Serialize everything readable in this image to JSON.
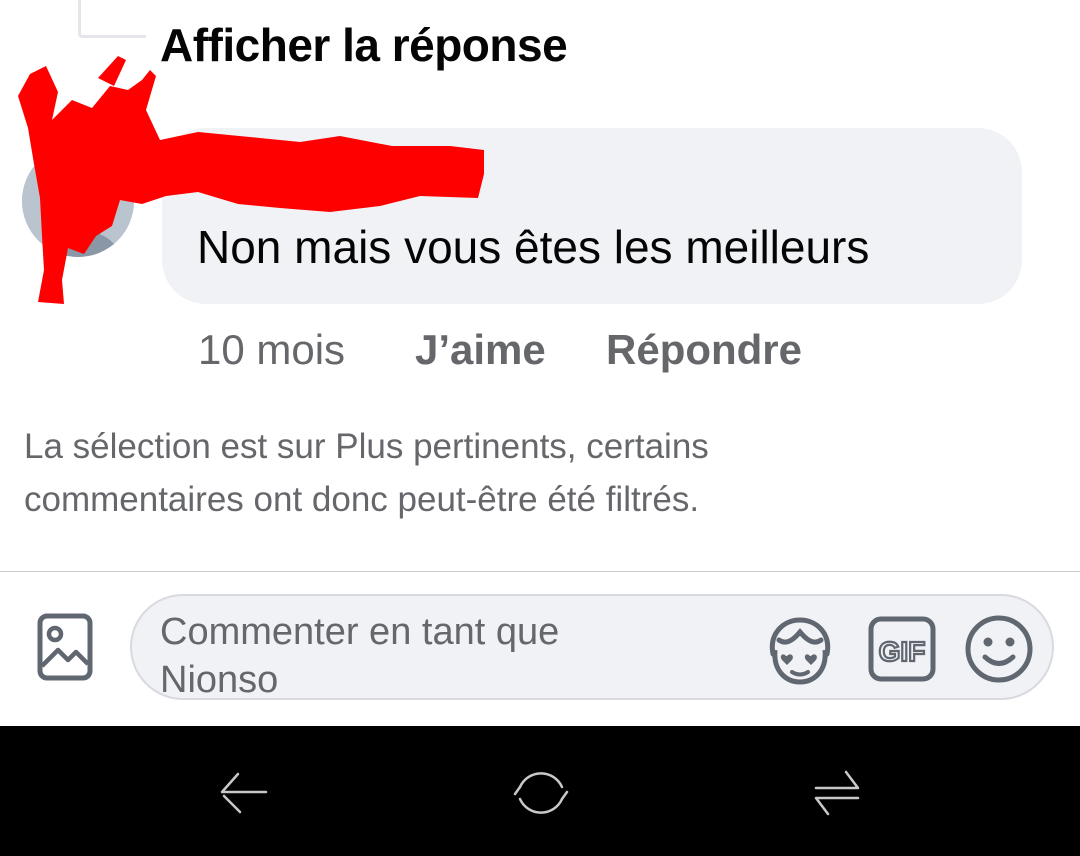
{
  "thread": {
    "view_reply_label": "Afficher la réponse"
  },
  "comment": {
    "author": "",
    "text": "Non mais vous êtes les meilleurs",
    "time": "10 mois",
    "like_label": "J’aime",
    "reply_label": "Répondre",
    "avatar_icon": "user-avatar",
    "redaction_color": "#ff0000"
  },
  "filter_notice": "La sélection est sur Plus pertinents, certains commentaires ont donc peut-être été filtrés.",
  "composer": {
    "placeholder": "Commenter en tant que Nionso",
    "photo_icon": "photo-icon",
    "avatar_sticker_icon": "avatar-sticker-icon",
    "gif_icon": "gif-icon",
    "gif_label": "GIF",
    "emoji_icon": "emoji-icon"
  },
  "system_nav": {
    "back_icon": "back-arrow-icon",
    "home_icon": "home-icon",
    "recents_icon": "recent-apps-icon"
  },
  "colors": {
    "text_primary": "#050505",
    "text_secondary": "#65676b",
    "bubble_bg": "#f0f2f5",
    "nav_bg": "#000000"
  }
}
